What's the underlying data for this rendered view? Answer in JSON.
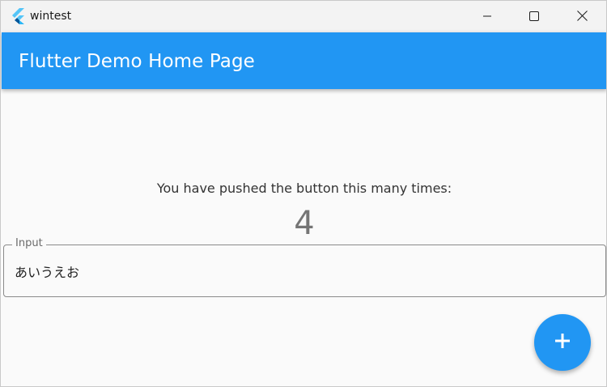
{
  "window": {
    "title": "wintest",
    "controls": {
      "minimize": "minimize-icon",
      "maximize": "maximize-icon",
      "close": "close-icon"
    }
  },
  "appbar": {
    "title": "Flutter Demo Home Page",
    "color": "#2196f3"
  },
  "main": {
    "counter_label": "You have pushed the button this many times:",
    "counter_value": "4"
  },
  "input": {
    "label": "Input",
    "value": "あいうえお"
  },
  "fab": {
    "icon": "plus-icon",
    "color": "#2196f3"
  }
}
